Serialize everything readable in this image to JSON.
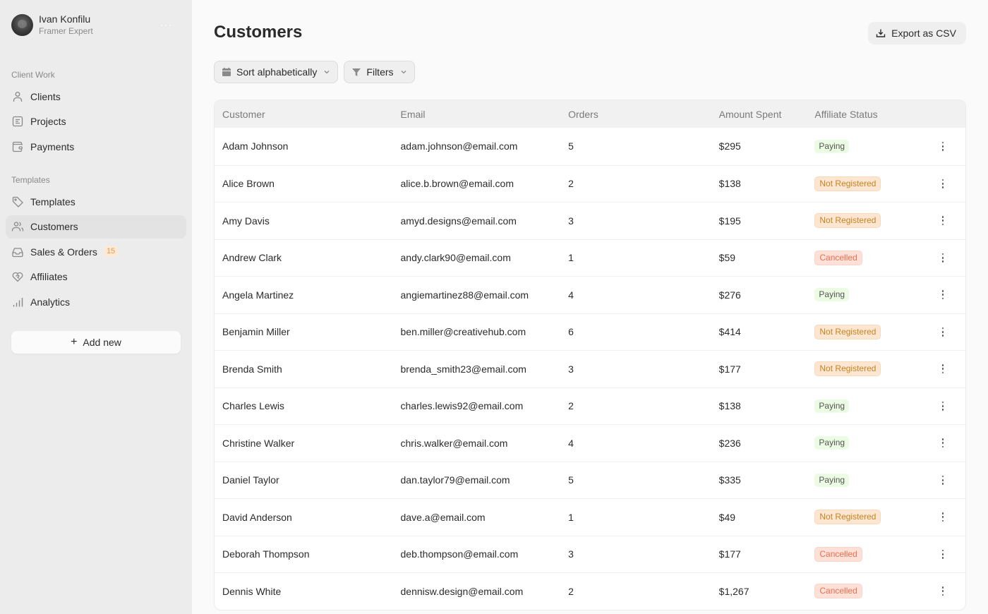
{
  "profile": {
    "name": "Ivan Konfilu",
    "role": "Framer Expert",
    "more": "···"
  },
  "sidebar": {
    "sections": [
      {
        "label": "Client Work",
        "items": [
          {
            "label": "Clients",
            "icon": "user-icon"
          },
          {
            "label": "Projects",
            "icon": "document-icon"
          },
          {
            "label": "Payments",
            "icon": "wallet-icon"
          }
        ]
      },
      {
        "label": "Templates",
        "items": [
          {
            "label": "Templates",
            "icon": "tag-icon"
          },
          {
            "label": "Customers",
            "icon": "users-icon",
            "active": true
          },
          {
            "label": "Sales & Orders",
            "icon": "inbox-icon",
            "badge": "15"
          },
          {
            "label": "Affiliates",
            "icon": "handshake-heart-icon"
          },
          {
            "label": "Analytics",
            "icon": "bar-chart-icon"
          }
        ]
      }
    ],
    "add_new": {
      "icon": "+",
      "label": "Add new"
    }
  },
  "page": {
    "title": "Customers",
    "export_label": "Export as CSV",
    "sort_label": "Sort alphabetically",
    "filters_label": "Filters"
  },
  "table": {
    "columns": [
      "Customer",
      "Email",
      "Orders",
      "Amount Spent",
      "Affiliate Status"
    ],
    "status_colors": {
      "Paying": "#ecfbe3",
      "Not Registered": "#fde6d1",
      "Cancelled": "#fde0d8"
    },
    "rows": [
      {
        "name": "Adam Johnson",
        "email": "adam.johnson@email.com",
        "orders": "5",
        "amount": "$295",
        "status": "Paying"
      },
      {
        "name": "Alice Brown",
        "email": "alice.b.brown@email.com",
        "orders": "2",
        "amount": "$138",
        "status": "Not Registered"
      },
      {
        "name": "Amy Davis",
        "email": "amyd.designs@email.com",
        "orders": "3",
        "amount": "$195",
        "status": "Not Registered"
      },
      {
        "name": "Andrew Clark",
        "email": "andy.clark90@email.com",
        "orders": "1",
        "amount": "$59",
        "status": "Cancelled"
      },
      {
        "name": "Angela Martinez",
        "email": "angiemartinez88@email.com",
        "orders": "4",
        "amount": "$276",
        "status": "Paying"
      },
      {
        "name": "Benjamin Miller",
        "email": "ben.miller@creativehub.com",
        "orders": "6",
        "amount": "$414",
        "status": "Not Registered"
      },
      {
        "name": "Brenda Smith",
        "email": "brenda_smith23@email.com",
        "orders": "3",
        "amount": "$177",
        "status": "Not Registered"
      },
      {
        "name": "Charles Lewis",
        "email": "charles.lewis92@email.com",
        "orders": "2",
        "amount": "$138",
        "status": "Paying"
      },
      {
        "name": "Christine Walker",
        "email": "chris.walker@email.com",
        "orders": "4",
        "amount": "$236",
        "status": "Paying"
      },
      {
        "name": "Daniel Taylor",
        "email": "dan.taylor79@email.com",
        "orders": "5",
        "amount": "$335",
        "status": "Paying"
      },
      {
        "name": "David Anderson",
        "email": "dave.a@email.com",
        "orders": "1",
        "amount": "$49",
        "status": "Not Registered"
      },
      {
        "name": "Deborah Thompson",
        "email": "deb.thompson@email.com",
        "orders": "3",
        "amount": "$177",
        "status": "Cancelled"
      },
      {
        "name": "Dennis White",
        "email": "dennisw.design@email.com",
        "orders": "2",
        "amount": "$1,267",
        "status": "Cancelled"
      }
    ]
  }
}
